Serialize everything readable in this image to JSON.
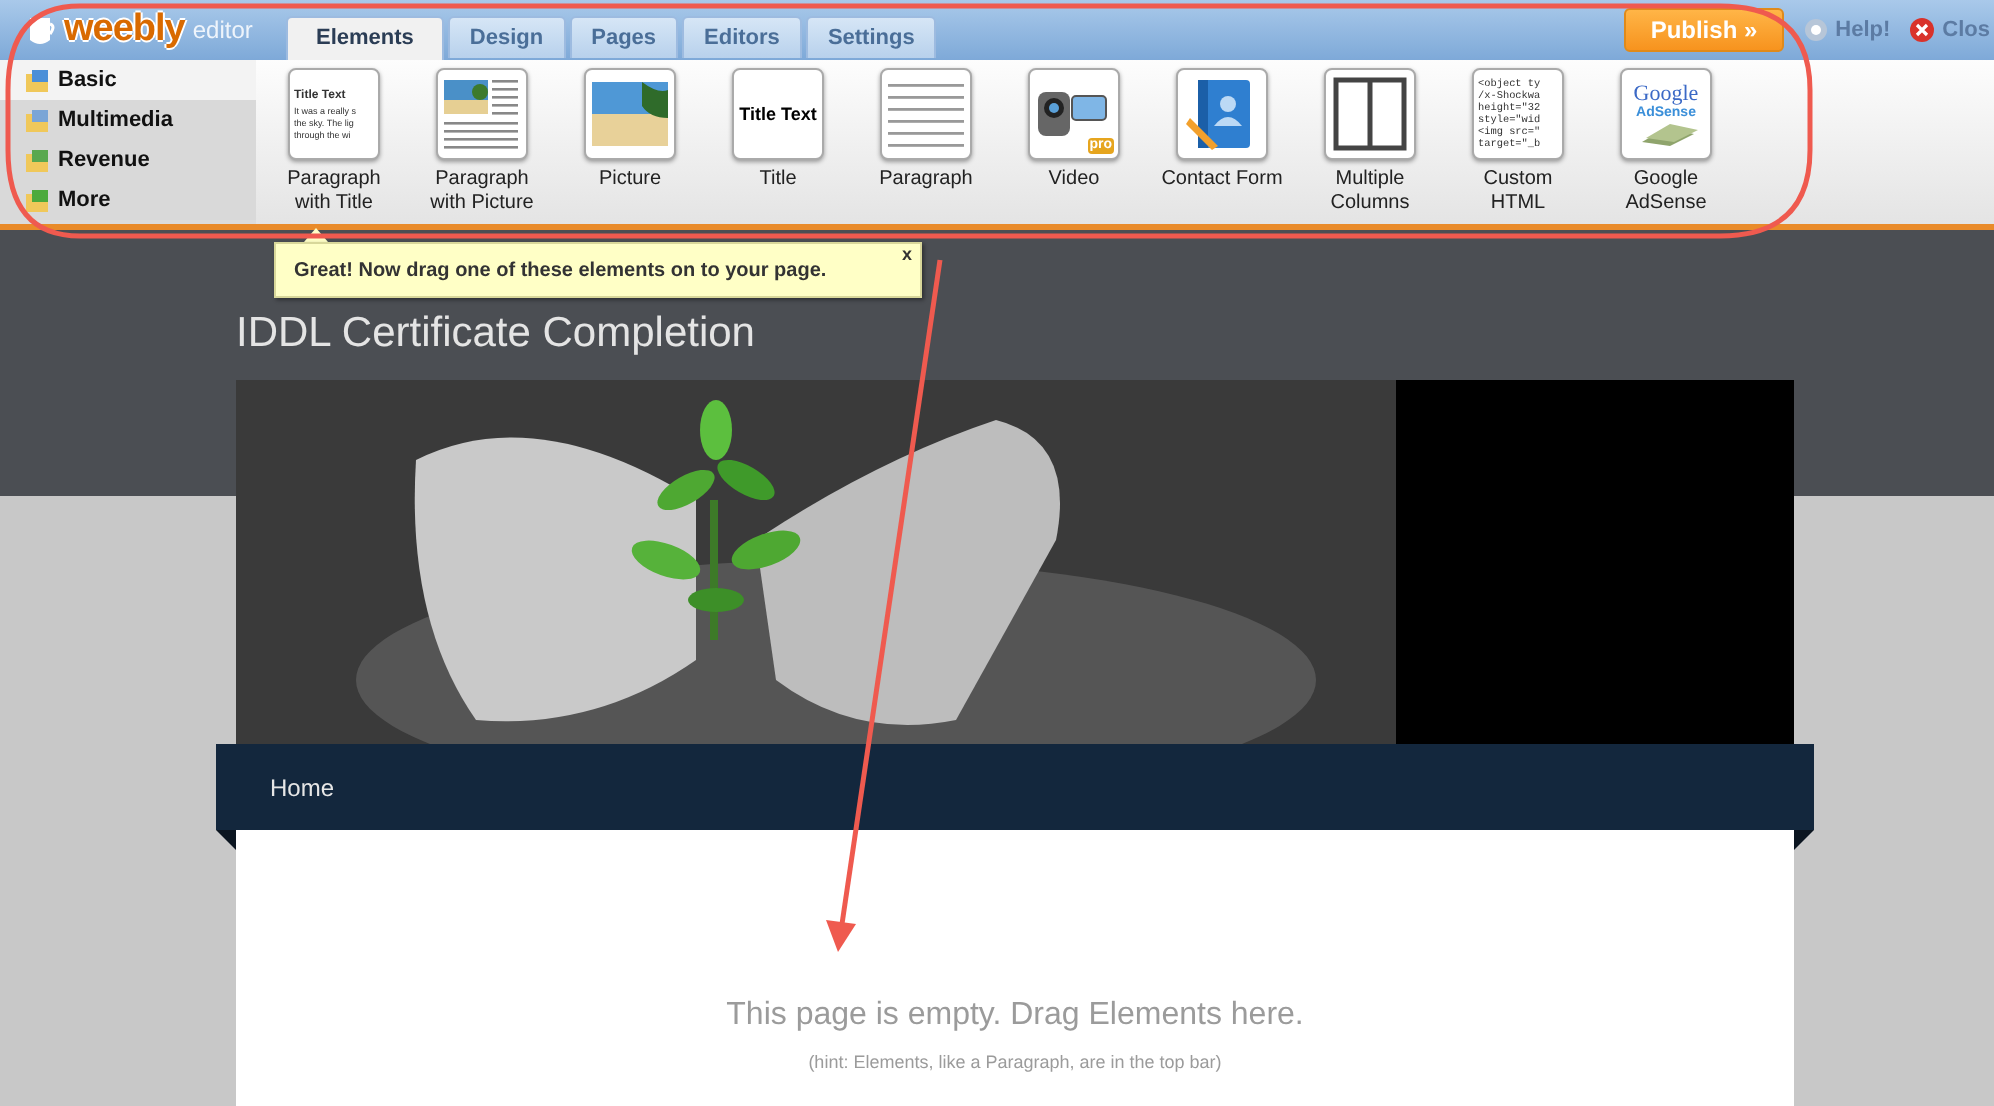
{
  "topbar": {
    "logo": "weebly",
    "logo_suffix": "editor",
    "tabs": [
      {
        "label": "Elements",
        "selected": true
      },
      {
        "label": "Design",
        "selected": false
      },
      {
        "label": "Pages",
        "selected": false
      },
      {
        "label": "Editors",
        "selected": false
      },
      {
        "label": "Settings",
        "selected": false
      }
    ],
    "publish": "Publish »",
    "help": "Help!",
    "close": "Clos"
  },
  "sidebar": {
    "items": [
      {
        "label": "Basic",
        "selected": true
      },
      {
        "label": "Multimedia",
        "selected": false
      },
      {
        "label": "Revenue",
        "selected": false
      },
      {
        "label": "More",
        "selected": false
      }
    ]
  },
  "elements": [
    {
      "kind": "para_title",
      "label": "Paragraph with Title",
      "thumb_lines": [
        "Title Text",
        "It was a really s",
        "the sky.  The lig",
        "through the wi"
      ]
    },
    {
      "kind": "para_picture",
      "label": "Paragraph with Picture"
    },
    {
      "kind": "picture",
      "label": "Picture"
    },
    {
      "kind": "title",
      "label": "Title",
      "thumb_lines": [
        "Title Text"
      ]
    },
    {
      "kind": "paragraph",
      "label": "Paragraph"
    },
    {
      "kind": "video",
      "label": "Video",
      "thumb_lines": [
        "pro"
      ]
    },
    {
      "kind": "contact",
      "label": "Contact Form"
    },
    {
      "kind": "columns",
      "label": "Multiple Columns"
    },
    {
      "kind": "html",
      "label": "Custom HTML",
      "thumb_lines": [
        "<object ty",
        "/x-Shockwa",
        "height=\"32",
        "style=\"wid",
        "<img src=\"",
        "target=\"_b"
      ]
    },
    {
      "kind": "adsense",
      "label": "Google AdSense",
      "thumb_lines": [
        "Google",
        "AdSense"
      ]
    }
  ],
  "tooltip": {
    "text": "Great! Now drag one of these elements on to your page.",
    "close": "x"
  },
  "site": {
    "title": "IDDL Certificate Completion",
    "nav": [
      {
        "label": "Home"
      }
    ],
    "empty_message": "This page is empty. Drag Elements here.",
    "hint": "(hint: Elements, like a Paragraph, are in the top bar)"
  }
}
